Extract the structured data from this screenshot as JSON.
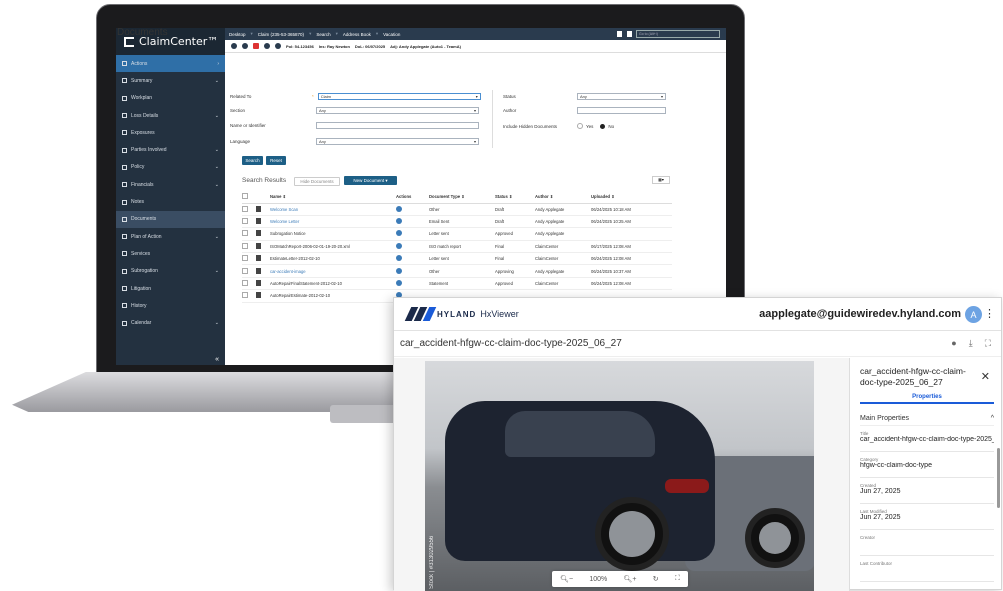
{
  "claimcenter": {
    "brand": "ClaimCenter™",
    "topnav": [
      "Desktop",
      "Claim (235-53-365870)",
      "Search",
      "Address Book",
      "Vacation"
    ],
    "search_placeholder": "Go to (Alt+/)",
    "info": {
      "pol": "Pol: 54-123456",
      "ins": "Ins: Ray Newton",
      "dol": "DoL: 06/07/2025",
      "adj": "Adj: Andy Applegate (Auto1 - TeamA)"
    },
    "sidebar": [
      {
        "label": "Actions",
        "chevron": "›"
      },
      {
        "label": "Summary",
        "chevron": "⌄"
      },
      {
        "label": "Workplan",
        "chevron": ""
      },
      {
        "label": "Loss Details",
        "chevron": "⌄"
      },
      {
        "label": "Exposures",
        "chevron": ""
      },
      {
        "label": "Parties Involved",
        "chevron": "⌄"
      },
      {
        "label": "Policy",
        "chevron": "⌄"
      },
      {
        "label": "Financials",
        "chevron": "⌄"
      },
      {
        "label": "Notes",
        "chevron": ""
      },
      {
        "label": "Documents",
        "chevron": ""
      },
      {
        "label": "Plan of Action",
        "chevron": "⌄"
      },
      {
        "label": "Services",
        "chevron": ""
      },
      {
        "label": "Subrogation",
        "chevron": "⌄"
      },
      {
        "label": "Litigation",
        "chevron": ""
      },
      {
        "label": "History",
        "chevron": ""
      },
      {
        "label": "Calendar",
        "chevron": "⌄"
      }
    ],
    "collapse": "«",
    "page_title": "Documents",
    "form": {
      "related_to_label": "Related To",
      "related_to_value": "Claim",
      "section_label": "Section",
      "section_value": "Any",
      "name_label": "Name or Identifier",
      "language_label": "Language",
      "language_value": "Any",
      "status_label": "Status",
      "status_value": "Any",
      "author_label": "Author",
      "hidden_label": "Include Hidden Documents",
      "yes": "Yes",
      "no": "No",
      "search_btn": "Search",
      "reset_btn": "Reset"
    },
    "results": {
      "title": "Search Results",
      "hide_btn": "Hide Documents",
      "new_btn": "New Document",
      "columns": [
        "Name ⇕",
        "Actions",
        "Document Type ⇕",
        "Status ⇕",
        "Author ⇕",
        "Uploaded ⇕"
      ],
      "rows": [
        [
          "Welcome Scan",
          "Other",
          "Draft",
          "Andy Applegate",
          "06/24/2025 10:18 AM"
        ],
        [
          "Welcome Letter",
          "Email Sent",
          "Draft",
          "Andy Applegate",
          "06/24/2025 10:25 AM"
        ],
        [
          "Subrogation Notice",
          "Letter sent",
          "Approved",
          "Andy Applegate",
          ""
        ],
        [
          "ISOMatchReport-2006-02-01-19-20-20.xml",
          "ISO match report",
          "Final",
          "ClaimCenter",
          "06/17/2025 12:08 AM"
        ],
        [
          "EstimateLetter-2012-02-10",
          "Letter sent",
          "Final",
          "ClaimCenter",
          "06/24/2025 12:08 AM"
        ],
        [
          "car-accident-image",
          "Other",
          "Approving",
          "Andy Applegate",
          "06/24/2025 10:37 AM"
        ],
        [
          "AutoRepairFinalStatement-2012-02-10",
          "Statement",
          "Approved",
          "ClaimCenter",
          "06/24/2025 12:08 AM"
        ],
        [
          "AutoRepairEstimate-2012-02-10",
          "",
          "",
          "",
          ""
        ]
      ]
    }
  },
  "hxviewer": {
    "brand": "HYLAND",
    "product": "HxViewer",
    "user_email": "aapplegate@guidewiredev.hyland.com",
    "avatar_letter": "A",
    "doc_title": "car_accident-hfgw-cc-claim-doc-type-2025_06_27",
    "watermark": "Stock | #313029556",
    "zoom": "100%",
    "panel": {
      "title": "car_accident-hfgw-cc-claim-doc-type-2025_06_27",
      "tab": "Properties",
      "section": "Main Properties",
      "fields": [
        {
          "label": "Title",
          "value": "car_accident-hfgw-cc-claim-doc-type-2025_06_27"
        },
        {
          "label": "Category",
          "value": "hfgw-cc-claim-doc-type"
        },
        {
          "label": "Created",
          "value": "Jun 27, 2025"
        },
        {
          "label": "Last Modified",
          "value": "Jun 27, 2025"
        },
        {
          "label": "Creator",
          "value": ""
        },
        {
          "label": "Last Contributor",
          "value": ""
        }
      ]
    }
  }
}
